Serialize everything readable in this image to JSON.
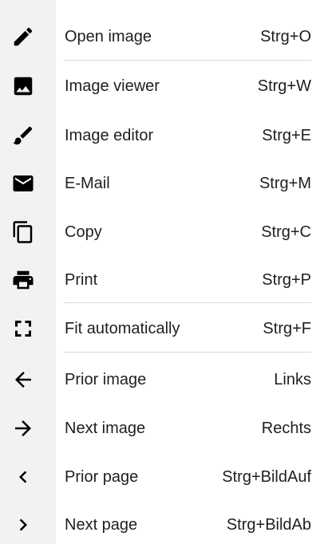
{
  "menu": {
    "items": [
      {
        "label": "Open image",
        "shortcut": "Strg+O",
        "icon": "pencil-icon"
      },
      {
        "label": "Image viewer",
        "shortcut": "Strg+W",
        "icon": "image-icon"
      },
      {
        "label": "Image editor",
        "shortcut": "Strg+E",
        "icon": "brush-icon"
      },
      {
        "label": "E-Mail",
        "shortcut": "Strg+M",
        "icon": "mail-icon"
      },
      {
        "label": "Copy",
        "shortcut": "Strg+C",
        "icon": "copy-icon"
      },
      {
        "label": "Print",
        "shortcut": "Strg+P",
        "icon": "print-icon"
      },
      {
        "label": "Fit automatically",
        "shortcut": "Strg+F",
        "icon": "fit-screen-icon"
      },
      {
        "label": "Prior image",
        "shortcut": "Links",
        "icon": "arrow-left-icon"
      },
      {
        "label": "Next image",
        "shortcut": "Rechts",
        "icon": "arrow-right-icon"
      },
      {
        "label": "Prior page",
        "shortcut": "Strg+BildAuf",
        "icon": "chevron-left-icon"
      },
      {
        "label": "Next page",
        "shortcut": "Strg+BildAb",
        "icon": "chevron-right-icon"
      }
    ]
  },
  "colors": {
    "text": "#1f1f1f",
    "icon": "#000000",
    "icon_column": "#f2f2f2",
    "separator": "#d9d9d9",
    "background": "#ffffff"
  }
}
